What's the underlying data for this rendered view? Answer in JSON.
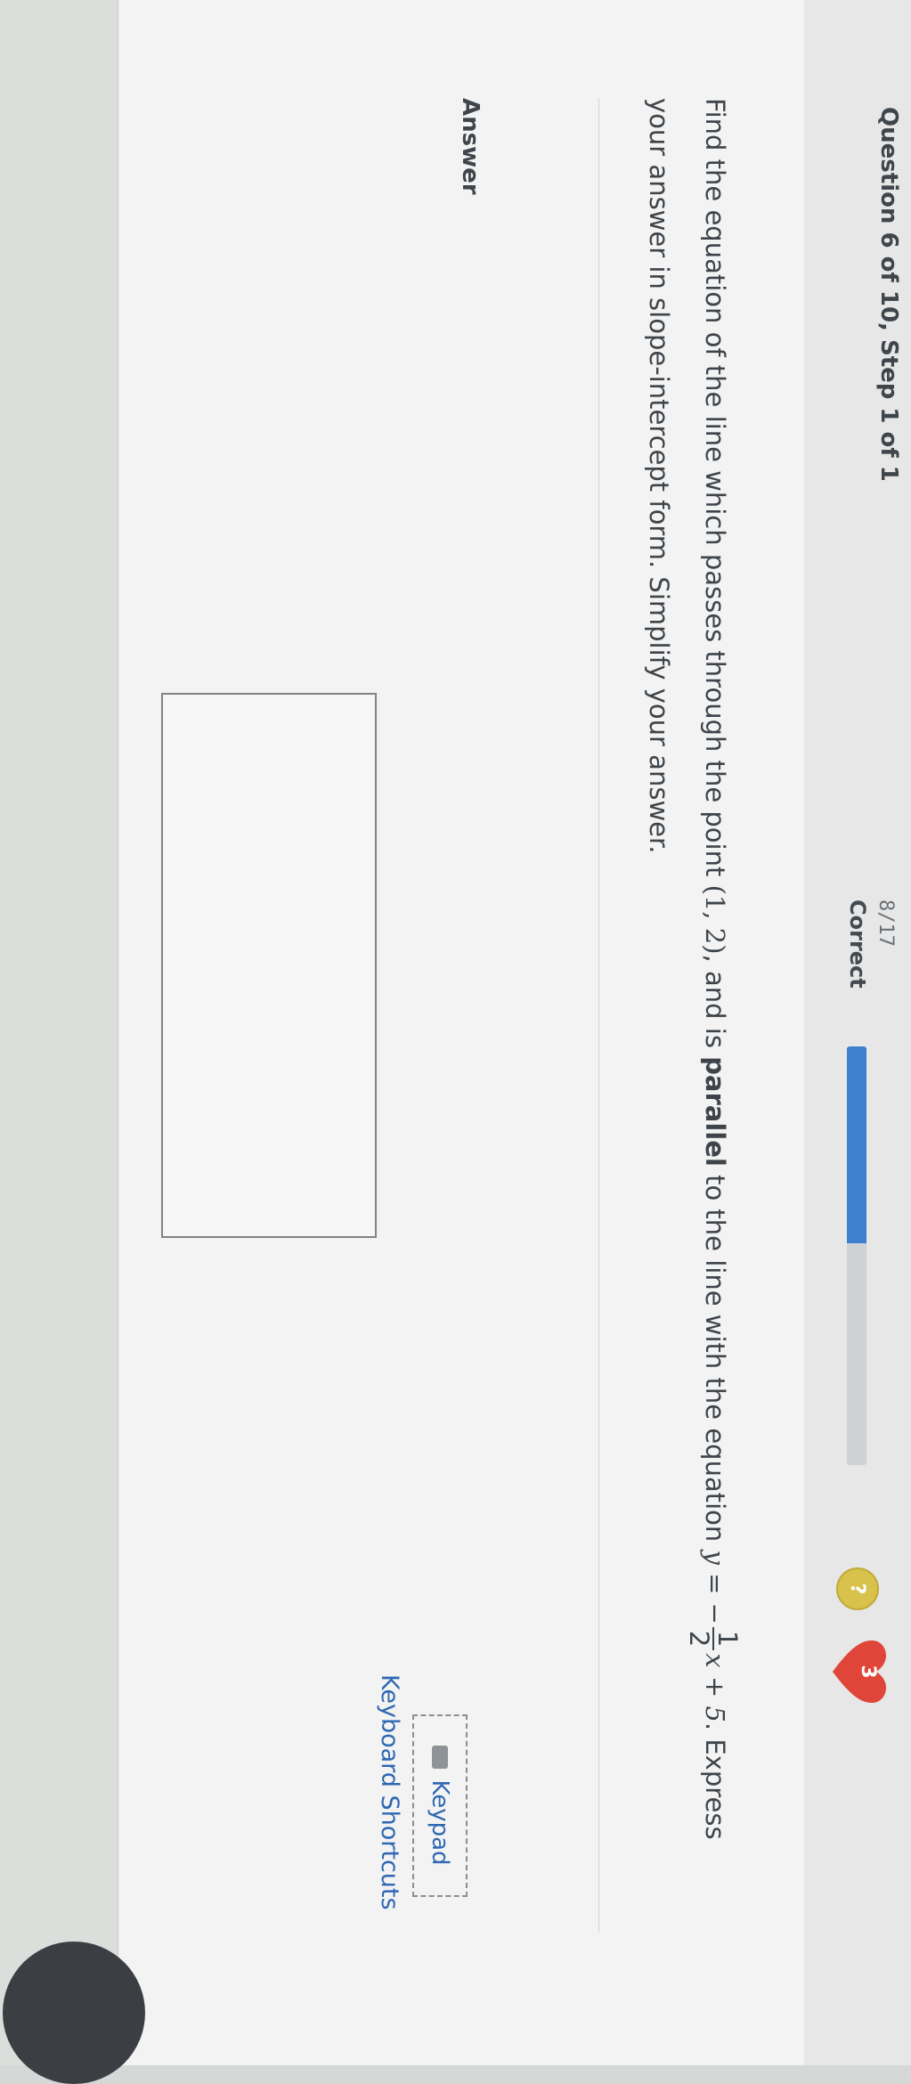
{
  "header": {
    "question_title": "Question 6 of 10, Step 1 of 1",
    "progress_fraction": "8/17",
    "progress_label": "Correct",
    "progress_ratio": 0.47,
    "help_badge": "?",
    "lives_count": "3",
    "accent_color": "#3f7fd0",
    "heart_color": "#e0453a"
  },
  "question": {
    "part1": "Find the equation of the line which passes through the point ",
    "point": "(1, 2)",
    "part2": ", and is ",
    "emphasis": "parallel",
    "part3": " to the line with the equation ",
    "eq_prefix": "y = −",
    "frac_num": "1",
    "frac_den": "2",
    "eq_suffix": "x + 5",
    "part4": ". Express your answer in slope-intercept form. Simplify your answer."
  },
  "answer": {
    "label": "Answer",
    "input_value": ""
  },
  "tools": {
    "keypad_label": "Keypad",
    "shortcuts_label": "Keyboard Shortcuts"
  }
}
